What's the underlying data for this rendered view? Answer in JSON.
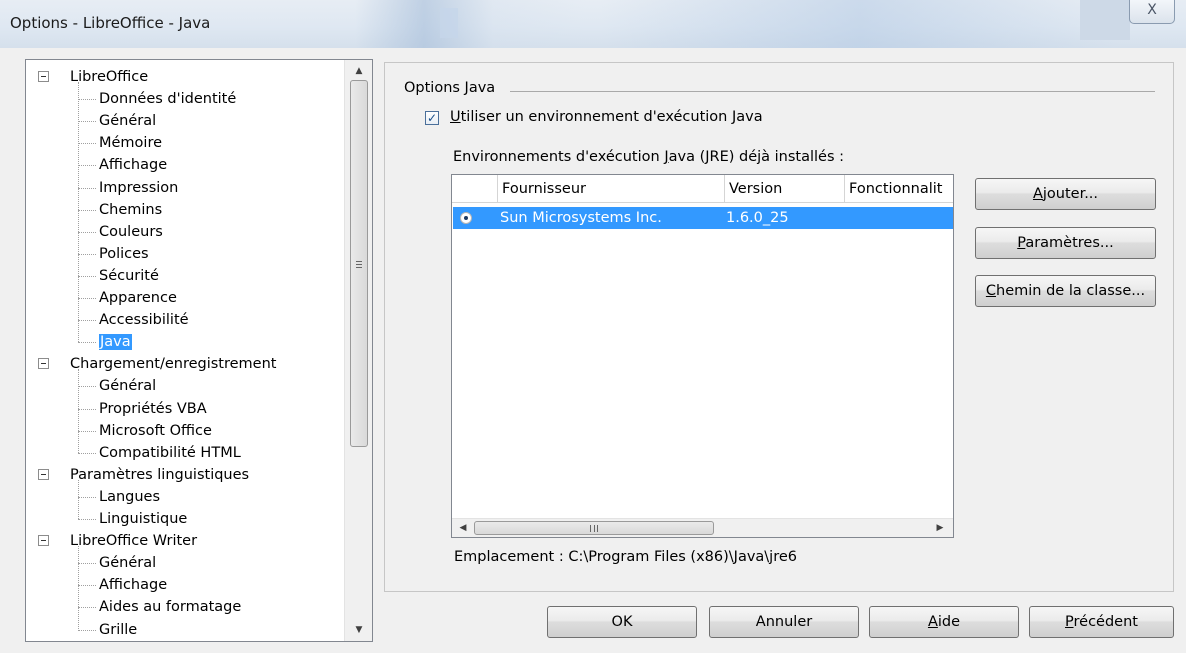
{
  "window": {
    "title": "Options - LibreOffice - Java",
    "close_glyph": "X"
  },
  "tree": {
    "items": [
      {
        "label": "LibreOffice",
        "level": 0,
        "expanded": true
      },
      {
        "label": "Données d'identité",
        "level": 1
      },
      {
        "label": "Général",
        "level": 1
      },
      {
        "label": "Mémoire",
        "level": 1
      },
      {
        "label": "Affichage",
        "level": 1
      },
      {
        "label": "Impression",
        "level": 1
      },
      {
        "label": "Chemins",
        "level": 1
      },
      {
        "label": "Couleurs",
        "level": 1
      },
      {
        "label": "Polices",
        "level": 1
      },
      {
        "label": "Sécurité",
        "level": 1
      },
      {
        "label": "Apparence",
        "level": 1
      },
      {
        "label": "Accessibilité",
        "level": 1
      },
      {
        "label": "Java",
        "level": 1,
        "selected": true
      },
      {
        "label": "Chargement/enregistrement",
        "level": 0,
        "expanded": true
      },
      {
        "label": "Général",
        "level": 1
      },
      {
        "label": "Propriétés VBA",
        "level": 1
      },
      {
        "label": "Microsoft Office",
        "level": 1
      },
      {
        "label": "Compatibilité HTML",
        "level": 1
      },
      {
        "label": "Paramètres linguistiques",
        "level": 0,
        "expanded": true
      },
      {
        "label": "Langues",
        "level": 1
      },
      {
        "label": "Linguistique",
        "level": 1
      },
      {
        "label": "LibreOffice Writer",
        "level": 0,
        "expanded": true
      },
      {
        "label": "Général",
        "level": 1
      },
      {
        "label": "Affichage",
        "level": 1
      },
      {
        "label": "Aides au formatage",
        "level": 1
      },
      {
        "label": "Grille",
        "level": 1
      }
    ]
  },
  "java": {
    "group_title": "Options Java",
    "use_jre_checked": true,
    "use_jre_label_first": "U",
    "use_jre_label_rest": "tiliser un environnement d'exécution Java",
    "installed_label_pre": "Environnements d'exécution ",
    "installed_label_key": "J",
    "installed_label_post": "ava (JRE) déjà installés :",
    "columns": [
      "Fournisseur",
      "Version",
      "Fonctionnalit"
    ],
    "rows": [
      {
        "vendor": "Sun Microsystems Inc.",
        "version": "1.6.0_25",
        "features": "",
        "selected": true
      }
    ],
    "location": "Emplacement : C:\\Program Files (x86)\\Java\\jre6"
  },
  "side_buttons": {
    "add_key": "A",
    "add_rest": "jouter...",
    "params_key": "P",
    "params_rest": "aramètres...",
    "classpath_key": "C",
    "classpath_rest": "hemin de la classe..."
  },
  "footer_buttons": {
    "ok": "OK",
    "cancel": "Annuler",
    "help_key": "A",
    "help_rest": "ide",
    "back_key": "P",
    "back_rest": "récédent"
  }
}
